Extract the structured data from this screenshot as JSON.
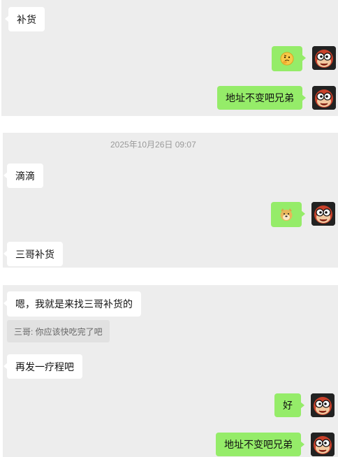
{
  "messages": {
    "m1": "补货",
    "m3": "地址不变吧兄弟",
    "timestamp": "2025年10月26日 09:07",
    "m4": "滴滴",
    "m6": "三哥补货",
    "m7": "嗯，我就是来找三哥补货的",
    "m7_quote": "三哥: 你应该快吃完了吧",
    "m8": "再发一疗程吧",
    "m9": "好",
    "m10": "地址不变吧兄弟"
  },
  "emoji": {
    "m2": "thinking-face-emoji",
    "m5": "doge-emoji"
  },
  "colors": {
    "panel_bg": "#ededed",
    "incoming_bubble": "#ffffff",
    "outgoing_bubble": "#95ec69",
    "quote_bg": "#e1e1e1",
    "timestamp_text": "#9a9a9a"
  }
}
